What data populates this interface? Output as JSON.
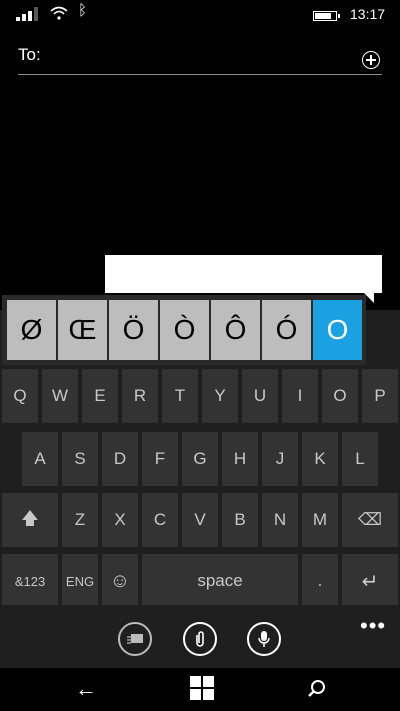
{
  "status_bar": {
    "time": "13:17",
    "bluetooth_icon": "ᛒ",
    "signal_bars": 3,
    "battery_level": 0.8
  },
  "compose": {
    "to_label": "To:"
  },
  "accent_picker": {
    "options": [
      "Ø",
      "Œ",
      "Ö",
      "Ò",
      "Ô",
      "Ó",
      "O"
    ],
    "selected": "O"
  },
  "keyboard": {
    "row1": [
      "Q",
      "W",
      "E",
      "R",
      "T",
      "Y",
      "U",
      "I",
      "O",
      "P"
    ],
    "row2": [
      "A",
      "S",
      "D",
      "F",
      "G",
      "H",
      "J",
      "K",
      "L"
    ],
    "row3": [
      "Z",
      "X",
      "C",
      "V",
      "B",
      "N",
      "M"
    ],
    "shift_icon": "🡅",
    "backspace_icon": "⌫",
    "num_label": "&123",
    "lang_label": "ENG",
    "emoji_icon": "☺",
    "space_label": "space",
    "period_label": ".",
    "enter_icon": "↵"
  },
  "nav": {
    "back_icon": "←",
    "search_icon": "⌕"
  }
}
